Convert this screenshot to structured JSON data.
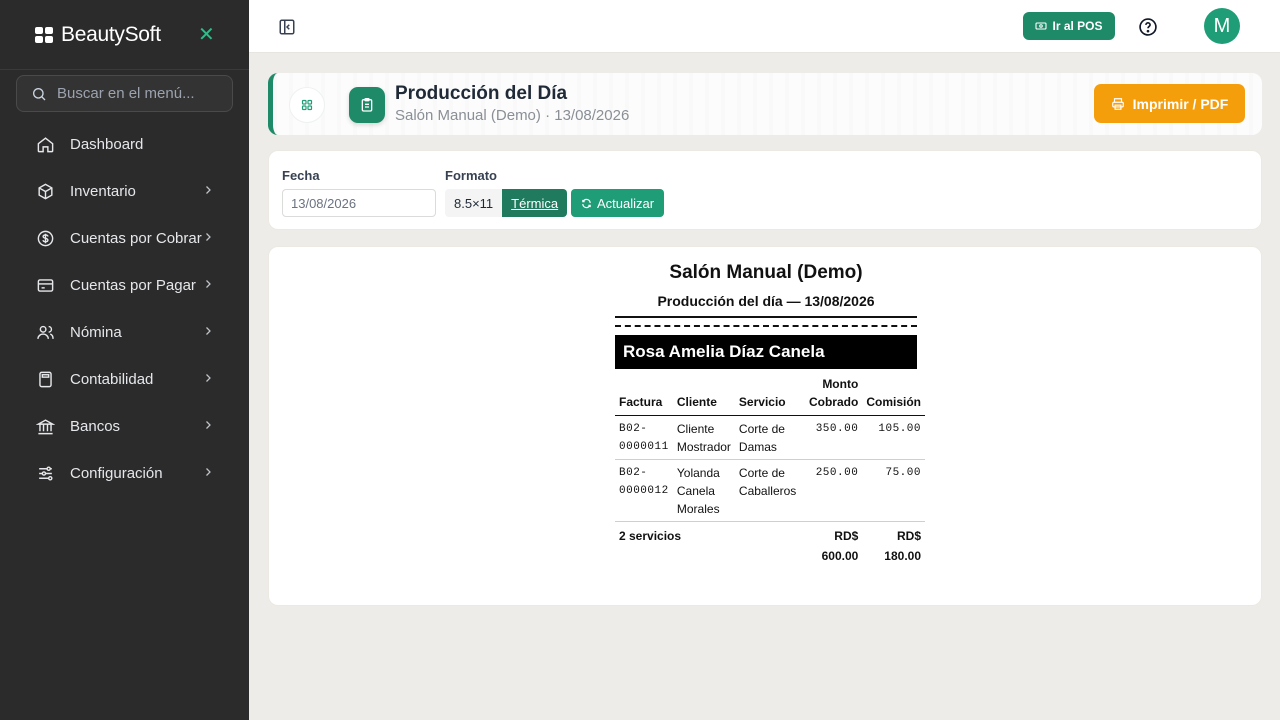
{
  "app": {
    "brand": "BeautySoft"
  },
  "search": {
    "placeholder": "Buscar en el menú..."
  },
  "sidebar": {
    "items": [
      {
        "label": "Dashboard",
        "icon": "home-icon",
        "has_children": false
      },
      {
        "label": "Inventario",
        "icon": "box-icon",
        "has_children": true
      },
      {
        "label": "Cuentas por Cobrar",
        "icon": "dollar-circle-icon",
        "has_children": true
      },
      {
        "label": "Cuentas por Pagar",
        "icon": "credit-card-icon",
        "has_children": true
      },
      {
        "label": "Nómina",
        "icon": "users-icon",
        "has_children": true
      },
      {
        "label": "Contabilidad",
        "icon": "calculator-icon",
        "has_children": true
      },
      {
        "label": "Bancos",
        "icon": "bank-icon",
        "has_children": true
      },
      {
        "label": "Configuración",
        "icon": "sliders-icon",
        "has_children": true
      }
    ]
  },
  "topbar": {
    "pos_label": "Ir al POS",
    "avatar_initial": "M"
  },
  "header": {
    "title": "Producción del Día",
    "subtitle": "Salón Manual (Demo) · 13/08/2026",
    "print_label": "Imprimir / PDF"
  },
  "filters": {
    "date_label": "Fecha",
    "date_value": "13/08/2026",
    "format_label": "Formato",
    "format_options": [
      "8.5×11",
      "Térmica"
    ],
    "format_selected": "Térmica",
    "refresh_label": "Actualizar"
  },
  "report": {
    "business": "Salón Manual (Demo)",
    "subtitle": "Producción del día — 13/08/2026",
    "employee": "Rosa Amelia Díaz Canela",
    "columns": [
      "Factura",
      "Cliente",
      "Servicio",
      "Monto Cobrado",
      "Comisión"
    ],
    "rows": [
      {
        "factura": "B02-0000011",
        "cliente": "Cliente Mostrador",
        "servicio": "Corte de Damas",
        "monto": "350.00",
        "comision": "105.00"
      },
      {
        "factura": "B02-0000012",
        "cliente": "Yolanda Canela Morales",
        "servicio": "Corte de Caballeros",
        "monto": "250.00",
        "comision": "75.00"
      }
    ],
    "total_label": "2 servicios",
    "total_monto": "RD$ 600.00",
    "total_comision": "RD$ 180.00"
  },
  "colors": {
    "accent": "#1f8a68",
    "print": "#f59e0b",
    "sidebar": "#2b2b2b"
  }
}
